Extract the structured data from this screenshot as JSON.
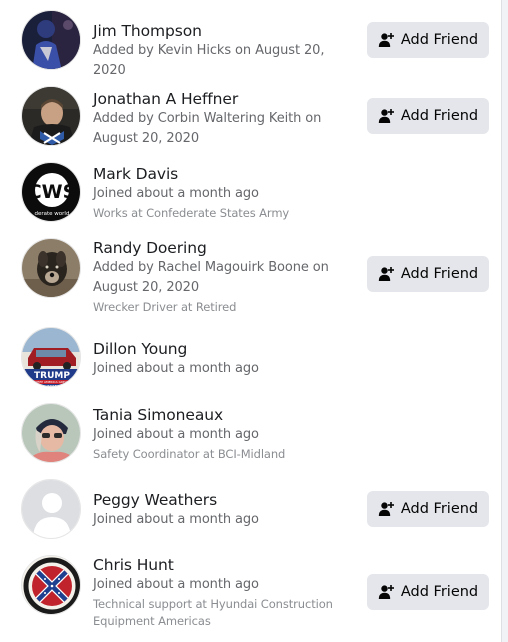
{
  "members": [
    {
      "name": "Jim Thompson",
      "meta": "Added by Kevin Hicks on August 20, 2020",
      "job": "",
      "button": "Add Friend",
      "avatar": "avatar-photo-jim-thompson"
    },
    {
      "name": "Jonathan A Heffner",
      "meta": "Added by Corbin Waltering Keith on August 20, 2020",
      "job": "",
      "button": "Add Friend",
      "avatar": "avatar-photo-jonathan-heffner"
    },
    {
      "name": "Mark Davis",
      "meta": "Joined about a month ago",
      "job": "Works at Confederate States Army",
      "button": "",
      "avatar": "avatar-photo-mark-davis"
    },
    {
      "name": "Randy Doering",
      "meta": "Added by Rachel Magouirk Boone on August 20, 2020",
      "job": "Wrecker Driver at Retired",
      "button": "Add Friend",
      "avatar": "avatar-photo-randy-doering"
    },
    {
      "name": "Dillon Young",
      "meta": "Joined about a month ago",
      "job": "",
      "button": "",
      "avatar": "avatar-photo-dillon-young"
    },
    {
      "name": "Tania Simoneaux",
      "meta": "Joined about a month ago",
      "job": "Safety Coordinator at BCI-Midland",
      "button": "",
      "avatar": "avatar-photo-tania-simoneaux"
    },
    {
      "name": "Peggy Weathers",
      "meta": "Joined about a month ago",
      "job": "",
      "button": "Add Friend",
      "avatar": "default-avatar-icon"
    },
    {
      "name": "Chris Hunt",
      "meta": "Joined about a month ago",
      "job": "Technical support at Hyundai Construction Equipment Americas",
      "button": "Add Friend",
      "avatar": "avatar-photo-chris-hunt"
    }
  ],
  "avatar_text": {
    "mark_davis_logo": "CWS",
    "mark_davis_caption": "derate world",
    "dillon_banner": "TRUMP",
    "dillon_sub": "KEEP AMERICA GREAT",
    "dillon_year": "2020"
  },
  "colors": {
    "button_bg": "#e4e6eb",
    "name": "#1c1e21",
    "meta": "#65676b",
    "job": "#8a8d91"
  }
}
